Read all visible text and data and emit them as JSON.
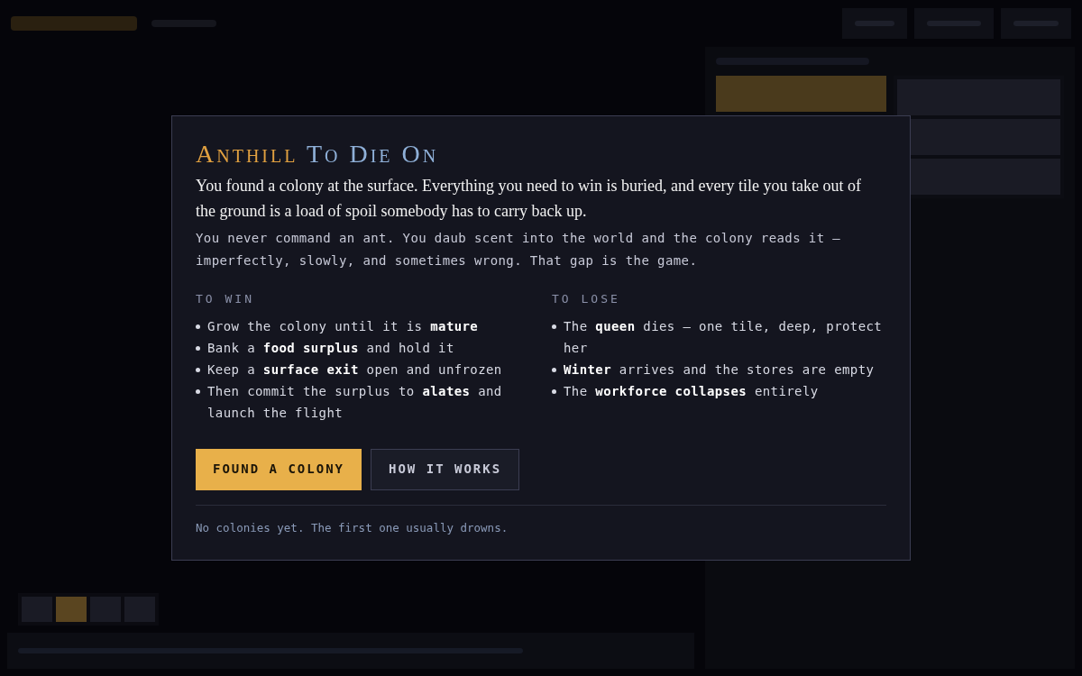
{
  "backdrop": {
    "speeds": [
      {
        "selected": false
      },
      {
        "selected": true
      },
      {
        "selected": false
      },
      {
        "selected": false
      }
    ],
    "brushes": [
      {
        "selected": true
      },
      {
        "selected": false
      },
      {
        "selected": false
      },
      {
        "selected": false
      }
    ]
  },
  "dialog": {
    "title_first": "Anthill",
    "title_rest": "To Die On",
    "intro": "You found a colony at the surface. Everything you need to win is buried, and every tile you take out of the ground is a load of spoil somebody has to carry back up.",
    "note": "You never command an ant. You daub scent into the world and the colony reads it — imperfectly, slowly, and sometimes wrong. That gap is the game.",
    "columns": [
      {
        "heading": "TO WIN",
        "items": [
          "Grow the colony until it is **mature**",
          "Bank a **food surplus** and hold it",
          "Keep a **surface exit** open and unfrozen",
          "Then commit the surplus to **alates** and launch the flight"
        ]
      },
      {
        "heading": "TO LOSE",
        "items": [
          "The **queen** dies — one tile, deep, protect her",
          "**Winter** arrives and the stores are empty",
          "The **workforce collapses** entirely"
        ]
      }
    ],
    "buttons": [
      {
        "label": "FOUND A COLONY",
        "kind": "primary"
      },
      {
        "label": "HOW IT WORKS",
        "kind": "secondary"
      }
    ],
    "footer": "No colonies yet. The first one usually drowns."
  }
}
